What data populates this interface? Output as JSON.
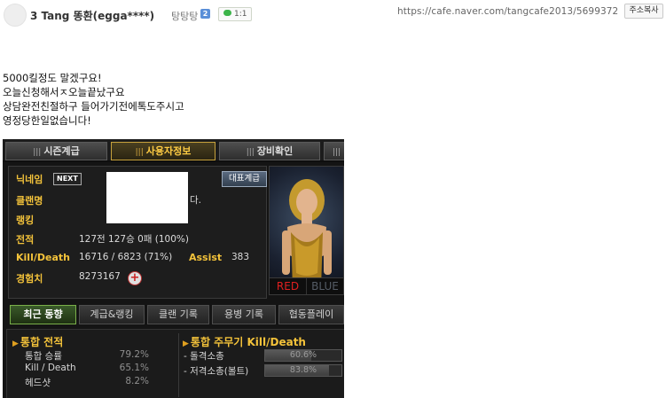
{
  "header": {
    "title": "3 Tang 똥환(egga****)",
    "author": "탕탕탕",
    "author_level": "2",
    "comment_count": "1:1",
    "url": "https://cafe.naver.com/tangcafe2013/5699372",
    "copy_button": "주소복사"
  },
  "post_body": [
    "5000킬정도 말겠구요!",
    "오늘신청해서ㅈ오늘끝났구요",
    "상담완전친절하구 들어가기전에톡도주시고",
    "영정당한일없습니다!"
  ],
  "game": {
    "tabs": [
      "시즌계급",
      "사용자정보",
      "장비확인"
    ],
    "active_tab": "사용자정보",
    "profile": {
      "nickname_label": "닉네임",
      "next_badge": "NEXT",
      "rep_rank_button": "대표계급",
      "clan_label": "클랜명",
      "clan_value_visible": "다.",
      "ranking_label": "랭킹",
      "record_label": "전적",
      "record_value": "127전 127승 0패 (100%)",
      "kd_label": "Kill/Death",
      "kd_value": "16716 / 6823 (71%)",
      "assist_label": "Assist",
      "assist_value": "383",
      "exp_label": "경험치",
      "exp_value": "8273167"
    },
    "team": {
      "red": "RED",
      "blue": "BLUE"
    },
    "subtabs": [
      "최근 동향",
      "계급&랭킹",
      "클랜 기록",
      "용병 기록",
      "협동플레이"
    ],
    "active_subtab": "최근 동향",
    "combined_record": {
      "title": "통합 전적",
      "rows": [
        {
          "label": "통합 승률",
          "value": "79.2%"
        },
        {
          "label": "Kill / Death",
          "value": "65.1%"
        },
        {
          "label": "헤드샷",
          "value": "8.2%"
        }
      ]
    },
    "weapon_kd": {
      "title": "통합 주무기 Kill/Death",
      "rows": [
        {
          "label": "- 돌격소총",
          "value": "60.6%",
          "fraction": 0.606
        },
        {
          "label": "- 저격소총(볼트)",
          "value": "83.8%",
          "fraction": 0.838
        }
      ]
    },
    "colors": {
      "accent": "#f3c23a",
      "red_team": "#e02020",
      "active_subtab": "#7ab04a"
    }
  }
}
